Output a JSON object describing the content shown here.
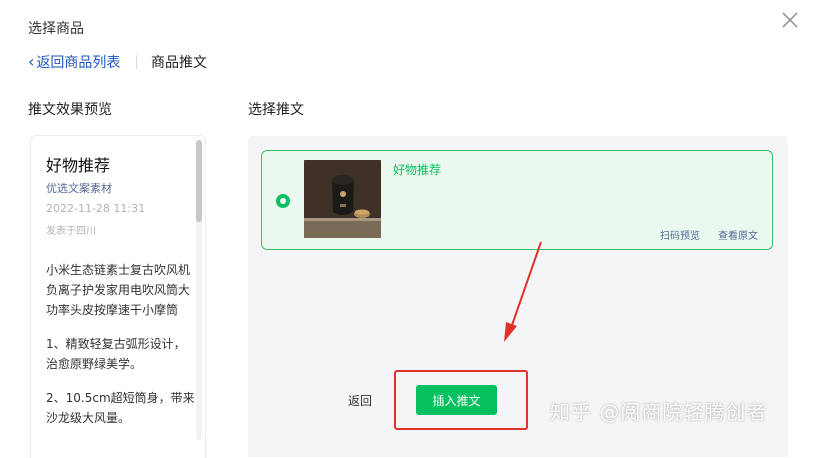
{
  "dialog": {
    "title": "选择商品"
  },
  "breadcrumb": {
    "back_label": "返回商品列表",
    "current": "商品推文"
  },
  "preview": {
    "heading": "推文效果预览",
    "article_title": "好物推荐",
    "source": "优选文案素材",
    "date": "2022-11-28 11:31",
    "location": "发表于四川",
    "paragraphs": [
      "小米生态链素士复古吹风机负离子护发家用电吹风筒大功率头皮按摩速干小摩筒",
      "1、精致轻复古弧形设计，治愈原野绿美学。",
      "2、10.5cm超短筒身，带来沙龙级大风量。"
    ]
  },
  "selection": {
    "heading": "选择推文",
    "article": {
      "title": "好物推荐",
      "scan_preview": "扫码预览",
      "view_original": "查看原文",
      "selected": true
    }
  },
  "footer": {
    "return_label": "返回",
    "insert_label": "插入推文"
  },
  "watermark": "知乎 @阅商院轻腾创者",
  "colors": {
    "accent": "#07c160",
    "link": "#576b95",
    "annotation": "#e0322b"
  }
}
